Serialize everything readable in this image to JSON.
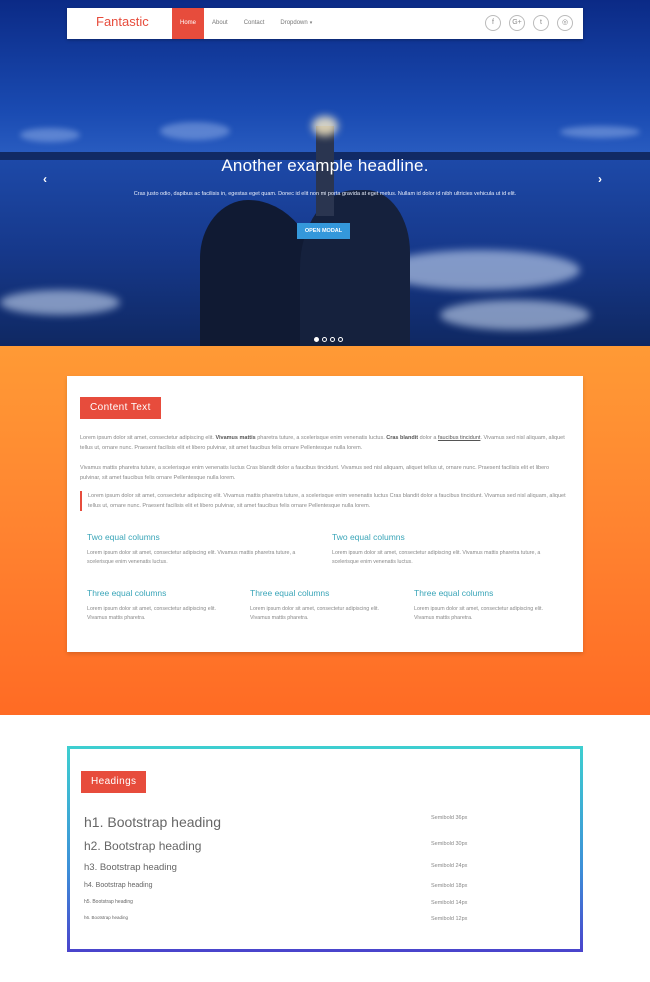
{
  "navbar": {
    "brand": "Fantastic",
    "links": [
      "Home",
      "About",
      "Contact",
      "Dropdown"
    ],
    "caret": "▾",
    "socials": [
      "f",
      "G+",
      "t",
      "◎"
    ]
  },
  "hero": {
    "title": "Another example headline.",
    "text": "Cras justo odio, dapibus ac facilisis in, egestas eget quam. Donec id elit non mi porta gravida at eget metus. Nullam id dolor id nibh ultricies vehicula ut id elit.",
    "button": "OPEN MODAL",
    "prev_icon": "‹",
    "next_icon": "›",
    "active_slide": 1
  },
  "content": {
    "label": "Content Text",
    "para1_a": "Lorem ipsum dolor sit amet, consectetur adipiscing elit.",
    "para1_b": "Vivamus mattis",
    "para1_c": "pharetra tuture, a scelerisque enim venenatis luctus.",
    "para1_d": "Cras blandit",
    "para1_e": "dolor a",
    "para1_f": "faucibus tincidunt",
    "para1_g": ". Vivamus sed nisl aliquam, aliquet tellus ut, ornare nunc. Praesent facilisis elit et libero pulvinar, sit amet faucibus felis ornare Pellentesque nulla lorem.",
    "para2": "Vivamus mattis pharetra tuture, a scelerisque enim venenatis luctus Cras blandit dolor a faucibus tincidunt. Vivamus sed nisl aliquam, aliquet tellus ut, ornare nunc. Praesent facilisis elit et libero pulvinar, sit amet faucibus felis ornare Pellentesque nulla lorem.",
    "quote": "Lorem ipsum dolor sit amet, consectetur adipiscing elit. Vivamus mattis pharetra tuture, a scelerisque enim venenatis luctus Cras blandit dolor a faucibus tincidunt. Vivamus sed nisl aliquam, aliquet tellus ut, ornare nunc. Praesent facilisis elit et libero pulvinar, sit amet faucibus felis ornare Pellentesque nulla lorem.",
    "two_col_title": "Two equal columns",
    "two_col_text": "Lorem ipsum dolor sit amet, consectetur adipiscing elit. Vivamus mattis pharetra tuture, a scelerisque enim venenatis luctus.",
    "three_col_title": "Three equal columns",
    "three_col_text": "Lorem ipsum dolor sit amet, consectetur adipiscing elit. Vivamus mattis pharetra."
  },
  "headings": {
    "label": "Headings",
    "rows": [
      {
        "text": "h1. Bootstrap heading",
        "size": "Semibold 36px"
      },
      {
        "text": "h2. Bootstrap heading",
        "size": "Semibold 30px"
      },
      {
        "text": "h3. Bootstrap heading",
        "size": "Semibold 24px"
      },
      {
        "text": "h4. Bootstrap heading",
        "size": "Semibold 18px"
      },
      {
        "text": "h5. Bootstrap heading",
        "size": "Semibold 14px"
      },
      {
        "text": "h6. Bootstrap heading",
        "size": "Semibold 12px"
      }
    ]
  },
  "colors": {
    "accent": "#e74c3c",
    "button": "#3498db",
    "teal": "#3aa5b8",
    "orange": "#ff8330"
  }
}
